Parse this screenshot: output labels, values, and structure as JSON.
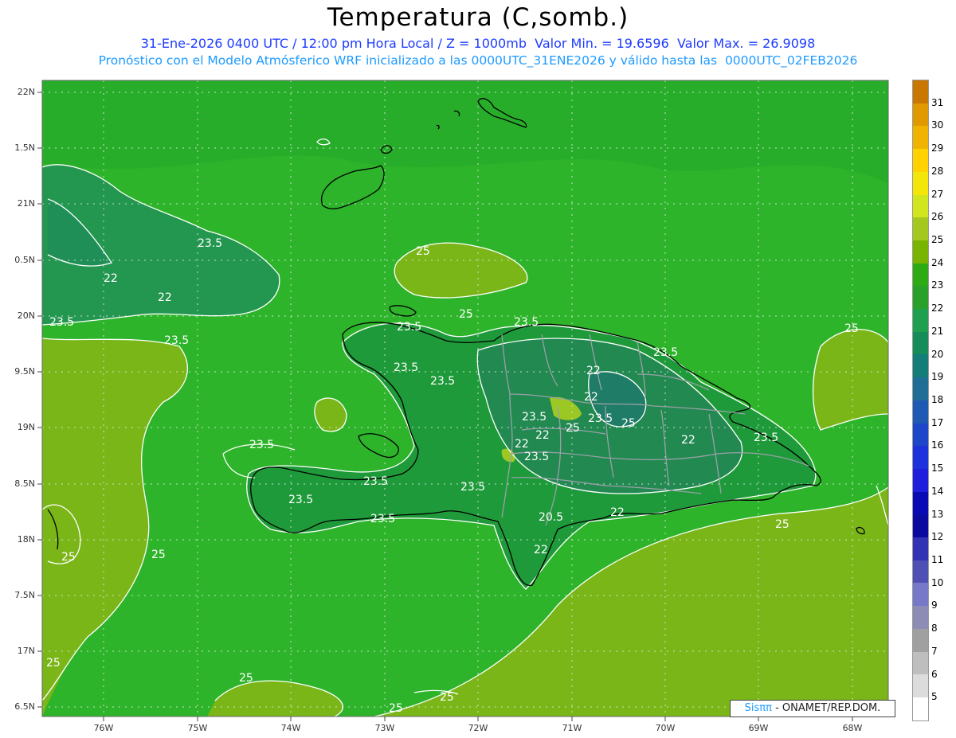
{
  "header": {
    "title": "Temperatura (C,somb.)",
    "line1": "31-Ene-2026 0400 UTC / 12:00 pm Hora Local / Z = 1000mb  Valor Min. = 19.6596  Valor Max. = 26.9098",
    "line2": "Pronóstico con el Modelo Atmósferico WRF inicializado a las 0000UTC_31ENE2026 y válido hasta las  0000UTC_02FEB2026"
  },
  "axes": {
    "y_ticks": [
      "22N",
      "1.5N",
      "21N",
      "0.5N",
      "20N",
      "9.5N",
      "19N",
      "8.5N",
      "18N",
      "7.5N",
      "17N",
      "6.5N"
    ],
    "x_ticks": [
      "76W",
      "75W",
      "74W",
      "73W",
      "72W",
      "71W",
      "70W",
      "69W",
      "68W"
    ]
  },
  "contour_labels": [
    "23.5",
    "23.5",
    "23.5",
    "23.5",
    "23.5",
    "23.5",
    "23.5",
    "23.5",
    "23.5",
    "23.5",
    "23.5",
    "23.5",
    "23.5",
    "23.5",
    "23.5",
    "23.5",
    "23.5",
    "22",
    "22",
    "22",
    "22",
    "22",
    "22",
    "22",
    "22",
    "20.5",
    "25",
    "25",
    "25",
    "25",
    "25",
    "25",
    "25",
    "25",
    "25",
    "25"
  ],
  "colorbar": {
    "labels": [
      "31",
      "30",
      "29",
      "28",
      "27",
      "26",
      "25",
      "24",
      "23",
      "22",
      "21",
      "20",
      "19",
      "18",
      "17",
      "16",
      "15",
      "14",
      "13",
      "12",
      "11",
      "10",
      "9",
      "8",
      "7",
      "6",
      "5"
    ],
    "colors": [
      "#c87800",
      "#e09a00",
      "#f0b400",
      "#ffd200",
      "#f5e60a",
      "#d2e61e",
      "#a5c81e",
      "#78b400",
      "#2eaa14",
      "#28a02a",
      "#1fa050",
      "#168c5a",
      "#147d78",
      "#1e6e96",
      "#1e5ab4",
      "#1e46c8",
      "#1e32dc",
      "#1e1edc",
      "#0a0ab4",
      "#0a0aa0",
      "#3232b4",
      "#5050b4",
      "#7878c8",
      "#8c8cb4",
      "#a0a0a0",
      "#bebebe",
      "#dcdcdc",
      "#ffffff"
    ]
  },
  "colors": {
    "ocean": "#2db42a",
    "land_warm": "#7bb618",
    "land_cool": "#238c50",
    "coast": "#000000",
    "contour": "#ffffff"
  },
  "footer": {
    "brand": "Sisππ",
    "credit": " - ONAMET/REP.DOM."
  }
}
